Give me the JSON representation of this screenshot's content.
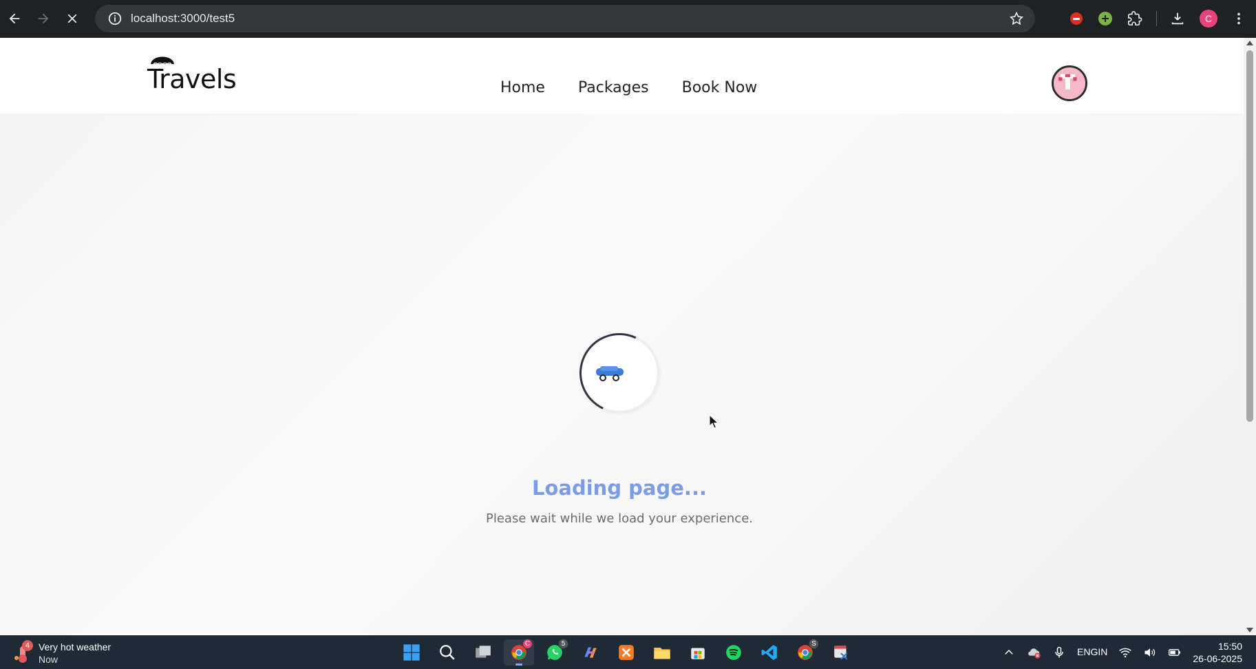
{
  "browser": {
    "url": "localhost:3000/test5",
    "profile_initial": "C"
  },
  "site": {
    "brand": "Travels",
    "nav": [
      "Home",
      "Packages",
      "Book Now"
    ]
  },
  "loader": {
    "title": "Loading page...",
    "subtitle": "Please wait while we load your experience."
  },
  "taskbar": {
    "weather_title": "Very hot weather",
    "weather_sub": "Now",
    "weather_badge": "4",
    "whatsapp_badge": "5",
    "chrome_badge": "C",
    "chrome2_badge": "S",
    "lang_line1": "ENG",
    "lang_line2": "IN",
    "time": "15:50",
    "date": "26-06-2025"
  },
  "colors": {
    "chrome_bg": "#202124",
    "omnibox_bg": "#35363a",
    "loading_title": "#7b9de6",
    "car": "#3b7ddd",
    "taskbar_bg": "#1f2a37"
  }
}
